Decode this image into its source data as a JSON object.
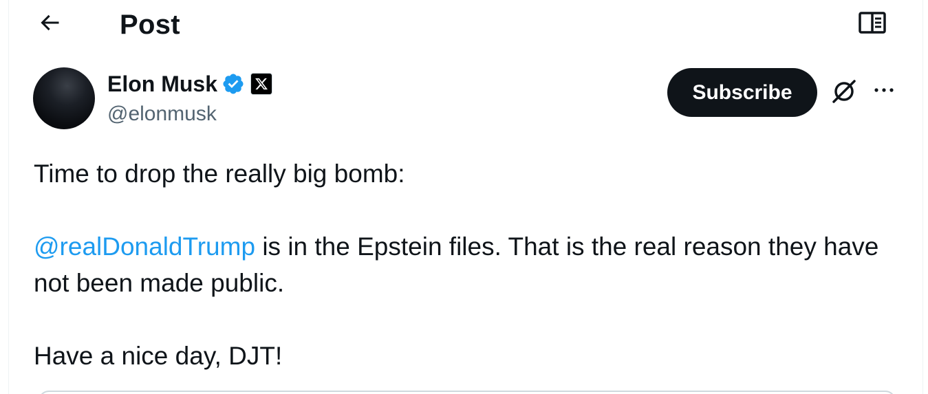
{
  "header": {
    "title": "Post",
    "back_icon": "arrow-left-icon",
    "reader_icon": "book-open-icon"
  },
  "author": {
    "display_name": "Elon Musk",
    "handle": "@elonmusk",
    "verified_icon": "verified-badge-icon",
    "affiliate_icon": "x-logo-icon",
    "verified_color": "#1d9bf0"
  },
  "actions": {
    "subscribe_label": "Subscribe",
    "grok_icon": "grok-icon",
    "more_icon": "more-dots-icon"
  },
  "tweet": {
    "line1": "Time to drop the really big bomb:",
    "mention": "@realDonaldTrump",
    "line2_rest": " is in the Epstein files. That is the real reason they have not been made public.",
    "line3": "Have a nice day, DJT!",
    "mention_color": "#1d9bf0"
  },
  "colors": {
    "text": "#0f1419",
    "secondary_text": "#536471",
    "button_bg": "#0f1419",
    "button_text": "#ffffff",
    "border": "#eff3f4"
  }
}
